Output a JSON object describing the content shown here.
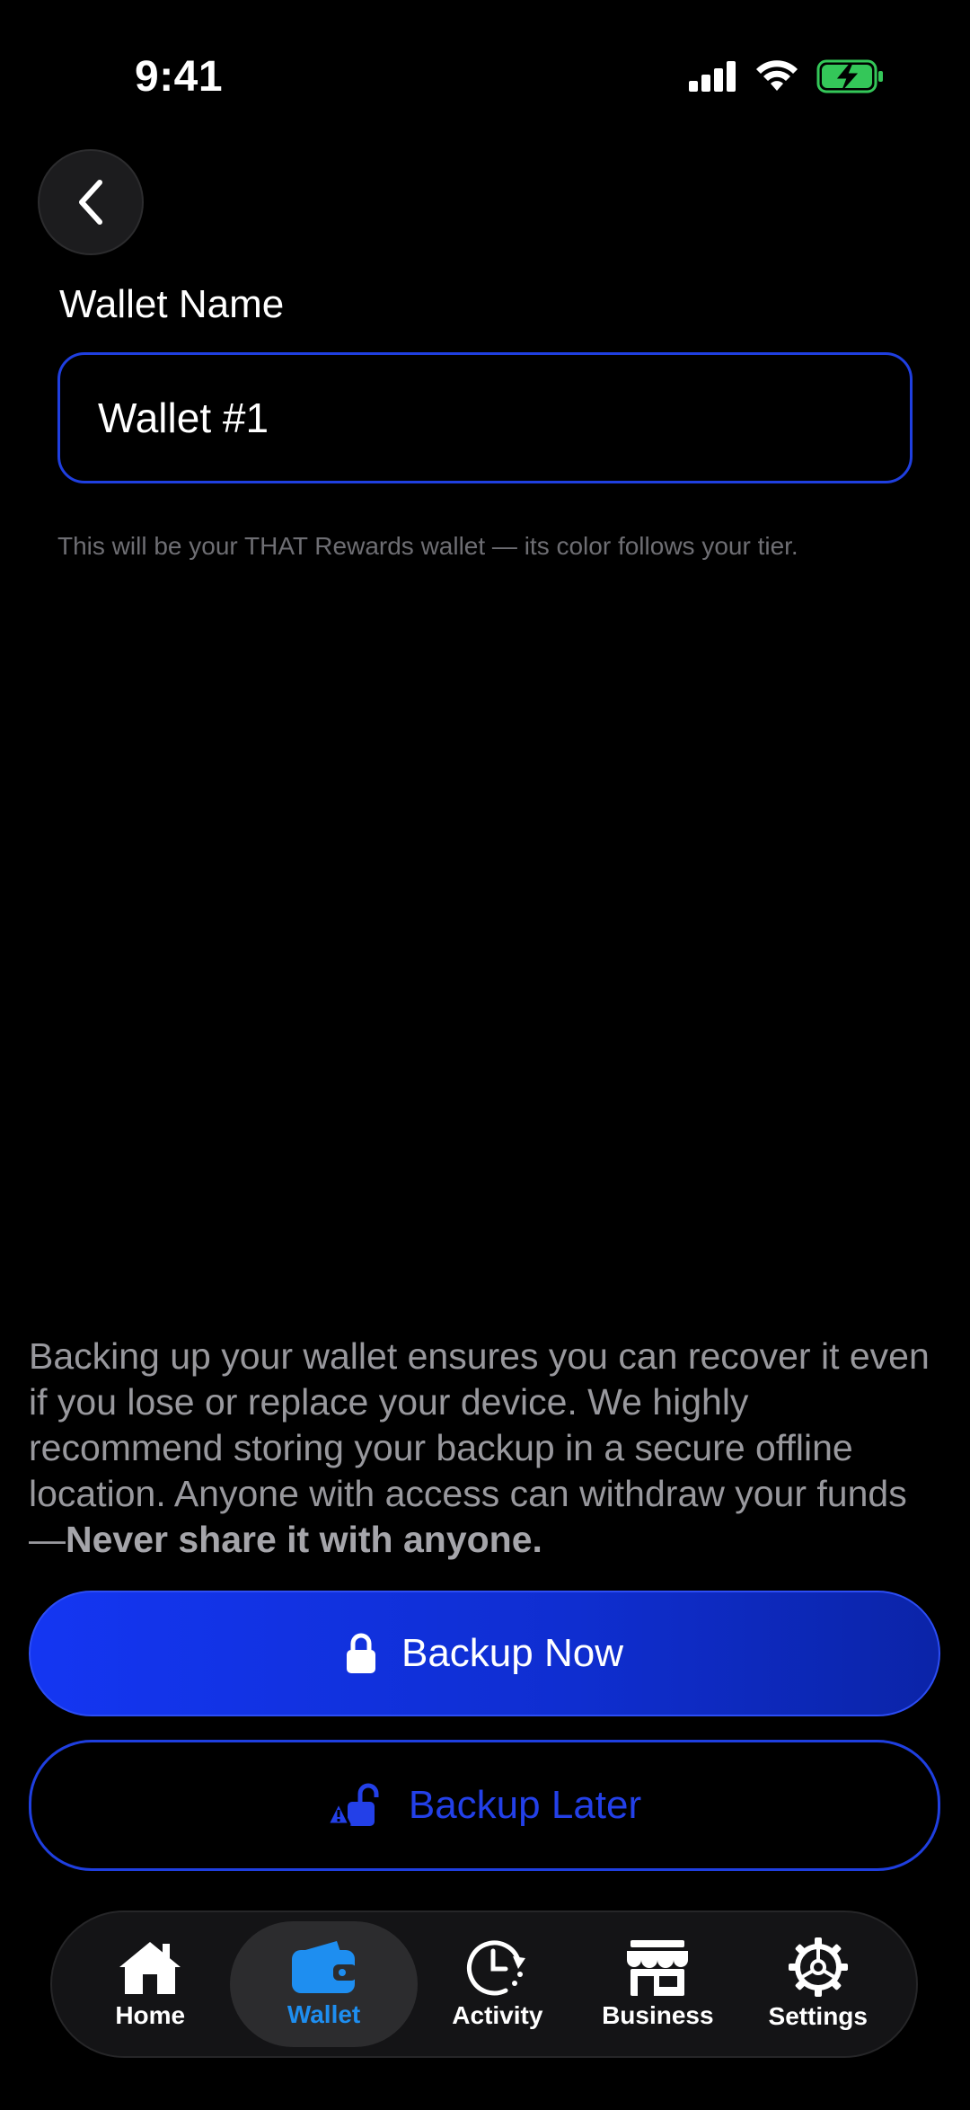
{
  "status_bar": {
    "time": "9:41"
  },
  "form": {
    "label": "Wallet Name",
    "value": "Wallet #1",
    "helper": "This will be your THAT Rewards wallet — its color follows your tier."
  },
  "backup": {
    "message": "Backing up your wallet ensures you can recover it even if you lose or replace your device. We highly recommend storing your backup in a secure offline location. Anyone with access can withdraw your funds—",
    "emphasis": "Never share it with anyone.",
    "primary_label": "Backup Now",
    "secondary_label": "Backup Later"
  },
  "tabs": [
    {
      "label": "Home",
      "icon": "home-icon"
    },
    {
      "label": "Wallet",
      "icon": "wallet-icon",
      "active": true
    },
    {
      "label": "Activity",
      "icon": "activity-icon"
    },
    {
      "label": "Business",
      "icon": "storefront-icon"
    },
    {
      "label": "Settings",
      "icon": "gear-icon"
    }
  ],
  "colors": {
    "accent": "#1f3fe0",
    "active_tab": "#1e8ef0",
    "battery": "#34c759"
  }
}
